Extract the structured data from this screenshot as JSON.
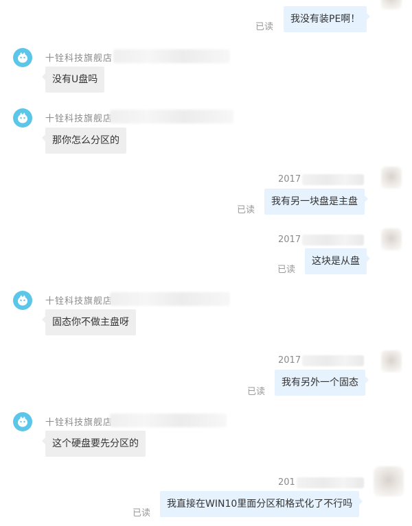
{
  "chat": {
    "read_label": "已读",
    "shop_name": "十铨科技旗舰店",
    "time_prefix": "2017",
    "time_prefix_short": "201",
    "messages": [
      {
        "text": "我没有装PE啊！"
      },
      {
        "text": "没有U盘吗"
      },
      {
        "text": "那你怎么分区的"
      },
      {
        "text": "我有另一块盘是主盘"
      },
      {
        "text": "这块是从盘"
      },
      {
        "text": "固态你不做主盘呀"
      },
      {
        "text": "我有另外一个固态"
      },
      {
        "text": "这个硬盘要先分区的"
      },
      {
        "text": "我直接在WIN10里面分区和格式化了不行吗"
      }
    ]
  },
  "colors": {
    "shop_avatar": "#5cc6e8",
    "incoming_bubble": "#eeeeee",
    "outgoing_bubble": "#e6f2fd",
    "meta_text": "#8a8a8a"
  }
}
